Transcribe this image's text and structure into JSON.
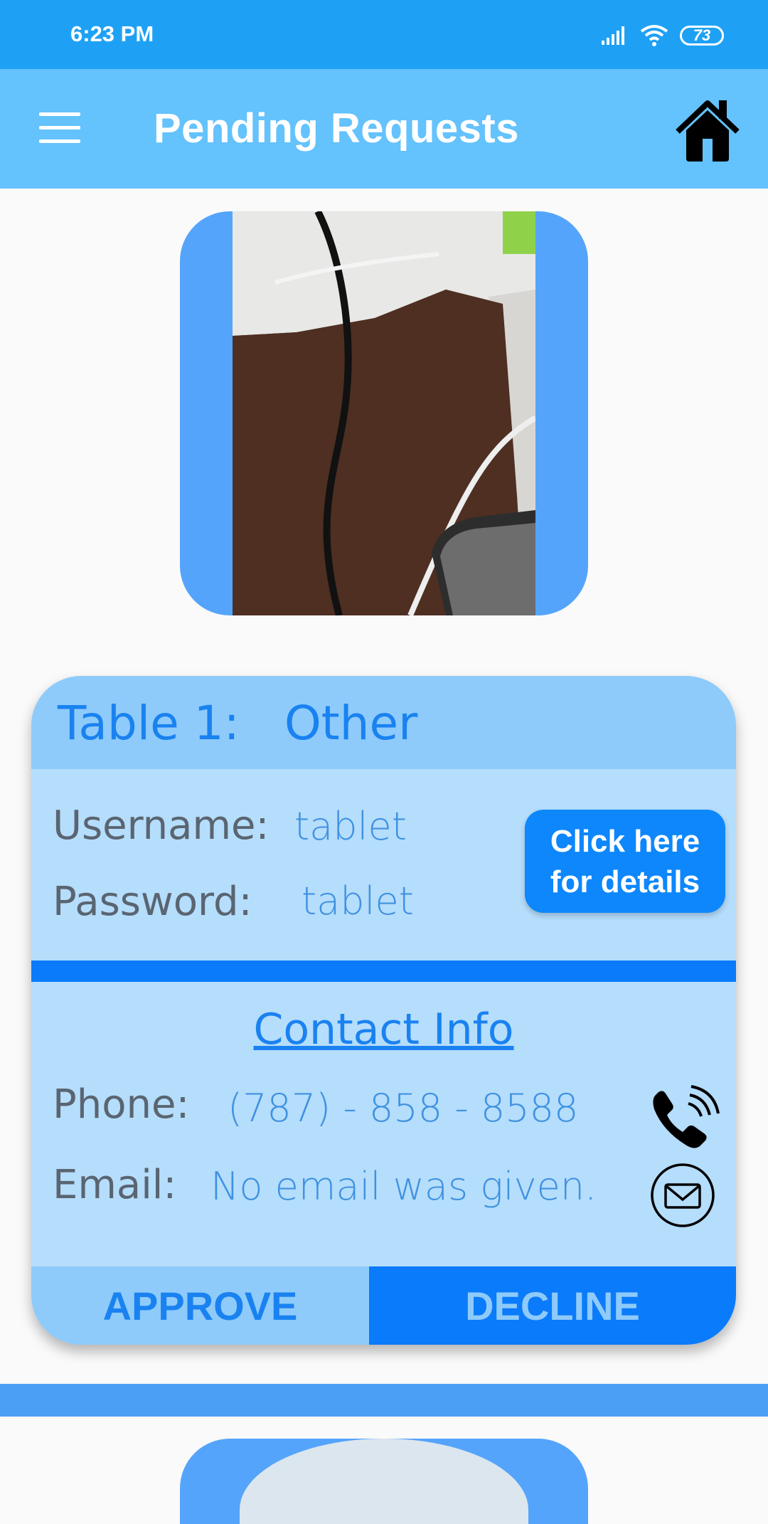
{
  "status_bar": {
    "time": "6:23 PM",
    "battery": "73",
    "icons": [
      "signal-icon",
      "wifi-icon",
      "battery-icon"
    ]
  },
  "app_bar": {
    "title": "Pending Requests",
    "menu_icon": "menu-icon",
    "home_icon": "home-icon"
  },
  "request": {
    "title": "Table 1:   Other",
    "username_label": "Username:",
    "username_value": "tablet",
    "password_label": "Password:",
    "password_value": "tablet",
    "details_button": "Click here\nfor details",
    "contact_title": "Contact Info",
    "phone_label": "Phone:",
    "phone_value": "(787) - 858 - 8588",
    "email_label": "Email:",
    "email_value": "No email was given.",
    "approve_label": "APPROVE",
    "decline_label": "DECLINE"
  },
  "colors": {
    "status_bar": "#1ea1f4",
    "app_bar": "#64c2fc",
    "accent": "#0a7bfa",
    "card_light": "#b5ddfc",
    "card_header": "#8ecbfa"
  }
}
